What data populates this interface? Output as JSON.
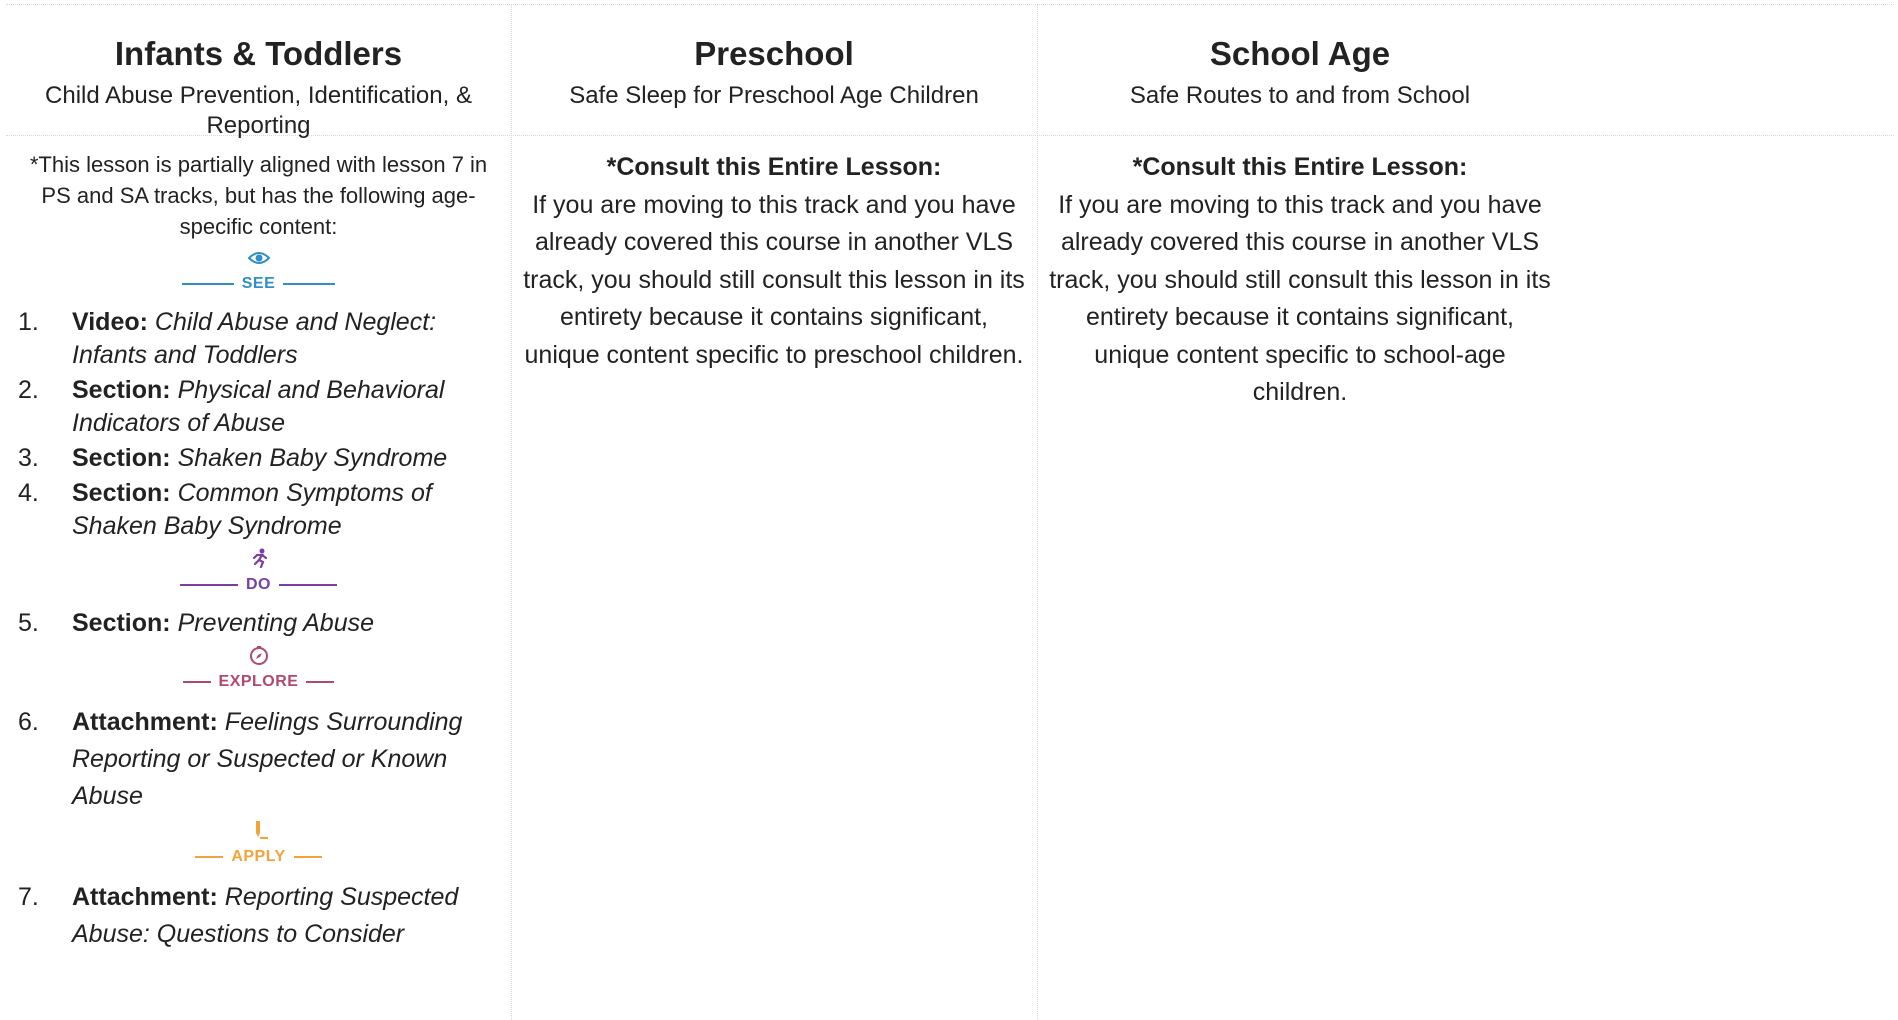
{
  "columns": [
    {
      "title": "Infants & Toddlers",
      "subtitle": "Child Abuse Prevention, Identification, & Reporting"
    },
    {
      "title": "Preschool",
      "subtitle": "Safe Sleep for Preschool Age Children"
    },
    {
      "title": "School Age",
      "subtitle": "Safe Routes to and from School"
    }
  ],
  "infants": {
    "note": "*This lesson is partially aligned with lesson 7 in PS and SA tracks, but has the following age-specific content:",
    "badges": {
      "see": {
        "label": "SEE",
        "icon": "eye-icon",
        "color": "#2f8fc6"
      },
      "do": {
        "label": "DO",
        "icon": "running-person-icon",
        "color": "#7a3fa0"
      },
      "explore": {
        "label": "EXPLORE",
        "icon": "compass-icon",
        "color": "#b04a6a"
      },
      "apply": {
        "label": "APPLY",
        "icon": "pencil-icon",
        "color": "#f2a33a"
      }
    },
    "items": [
      {
        "num": "1.",
        "label": "Video:",
        "text": "Child Abuse and Neglect: Infants and Toddlers"
      },
      {
        "num": "2.",
        "label": "Section:",
        "text": "Physical and Behavioral Indicators of Abuse"
      },
      {
        "num": "3.",
        "label": "Section:",
        "text": "Shaken Baby Syndrome"
      },
      {
        "num": "4.",
        "label": "Section:",
        "text": "Common Symptoms of Shaken Baby Syndrome"
      },
      {
        "num": "5.",
        "label": "Section:",
        "text": "Preventing Abuse"
      },
      {
        "num": "6.",
        "label": "Attachment:",
        "text": "Feelings Surrounding Reporting or Suspected or Known Abuse"
      },
      {
        "num": "7.",
        "label": "Attachment:",
        "text": "Reporting Suspected Abuse: Questions to Consider"
      }
    ]
  },
  "preschool": {
    "heading": "*Consult this Entire Lesson:",
    "text": "If you are moving to this track and you have already covered this course in another VLS track, you should still consult this lesson in its entirety because it contains significant, unique content specific to preschool children."
  },
  "school_age": {
    "heading": "*Consult this Entire Lesson:",
    "text": "If you are moving to this track and you have already covered this course in another VLS track, you should still consult this lesson in its entirety because it contains significant, unique content specific to school-age children."
  }
}
